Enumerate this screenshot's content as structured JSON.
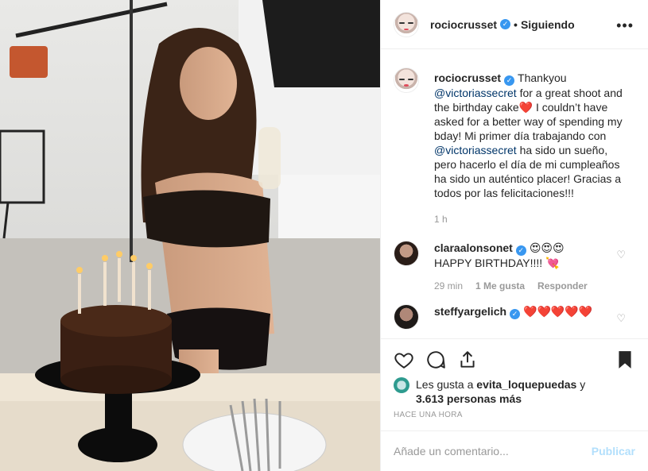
{
  "post": {
    "author": "rociocrusset",
    "follow_status": "Siguiendo",
    "dot": "•",
    "more": "•••",
    "caption": {
      "t1": "Thankyou ",
      "mention1": "@victoriassecret",
      "t2": " for a great shoot and the birthday cake",
      "heart": "❤️",
      "t3": " I couldn’t have asked for a better way of spending my bday! Mi primer día trabajando con ",
      "mention2": "@victoriassecret",
      "t4": " ha sido un sueño, pero hacerlo el día de mi cumpleaños ha sido un auténtico placer! Gracias a todos por las felicitaciones!!!",
      "time": "1 h"
    },
    "comments": [
      {
        "user": "claraalonsonet",
        "emojis": "😍😍😍",
        "text": "HAPPY BIRTHDAY!!!! 💘",
        "time": "29 min",
        "likes": "1 Me gusta",
        "reply": "Responder"
      },
      {
        "user": "steffyargelich",
        "emojis": "❤️❤️❤️❤️❤️"
      }
    ],
    "likes_line": {
      "prefix": "Les gusta a ",
      "user": "evita_loquepuedas",
      "joiner": " y",
      "count": "3.613 personas más"
    },
    "timestamp": "HACE UNA HORA",
    "comment_input": {
      "placeholder": "Añade un comentario...",
      "publish": "Publicar"
    },
    "icons": {
      "like": "heart-icon",
      "comment": "comment-icon",
      "share": "share-icon",
      "save": "bookmark-icon"
    },
    "colors": {
      "verified": "#3897f0",
      "mention": "#003569",
      "publish_disabled": "#b2dffc",
      "muted": "#999999"
    }
  }
}
